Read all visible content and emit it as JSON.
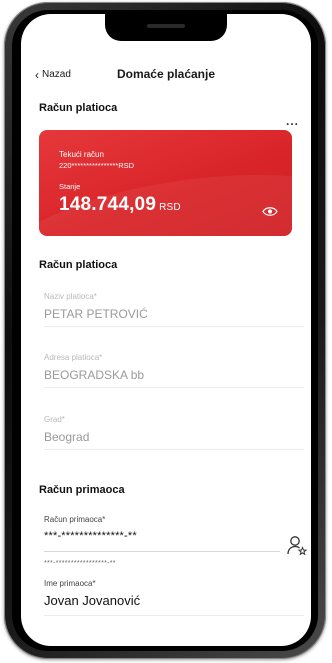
{
  "nav": {
    "back_label": "Nazad",
    "title": "Domaće plaćanje"
  },
  "payer_section": {
    "title": "Račun platioca",
    "more_label": "..."
  },
  "card": {
    "account_type": "Tekući račun",
    "account_number": "220****************RSD",
    "balance_label": "Stanje",
    "balance_value": "148.744,09",
    "currency": "RSD",
    "color": "#d9262b"
  },
  "payer_form": {
    "title": "Račun platioca",
    "name_label": "Naziv platioca*",
    "name_value": "PETAR PETROVIĆ",
    "address_label": "Adresa platioca*",
    "address_value": "BEOGRADSKA bb",
    "city_label": "Grad*",
    "city_value": "Beograd"
  },
  "recipient_section": {
    "title": "Račun primaoca",
    "account_label": "Račun primaoca*",
    "account_value": "***-**************-**",
    "account_hint": "***-*****************-**",
    "name_label": "Ime primaoca*",
    "name_value": "Jovan Jovanović"
  }
}
